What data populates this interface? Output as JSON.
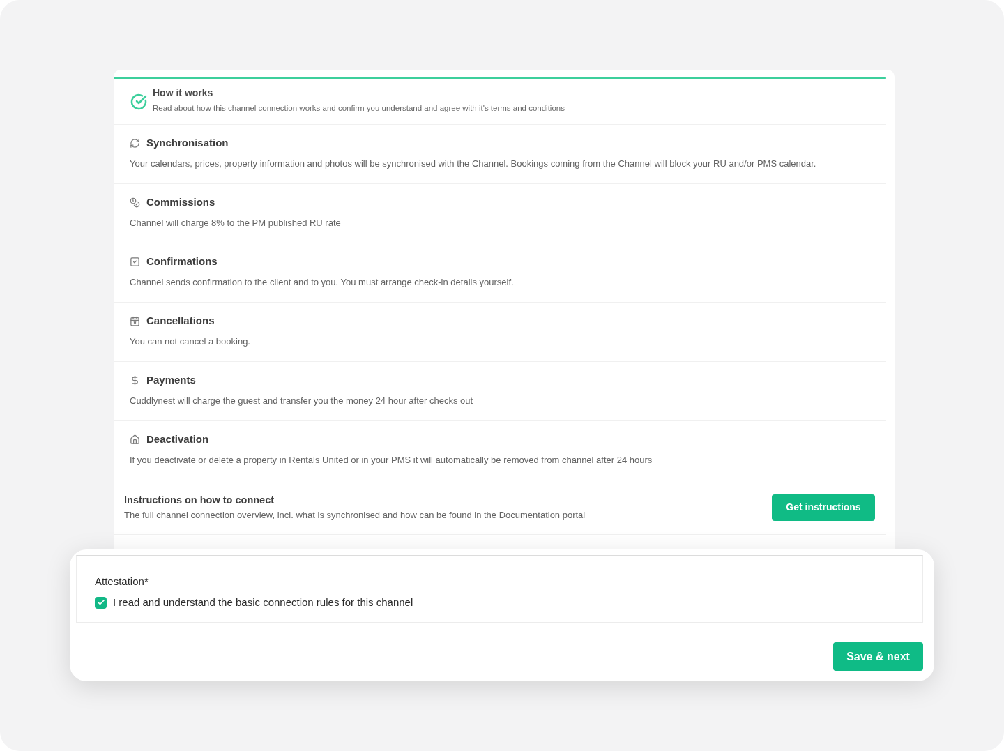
{
  "header": {
    "title": "How it works",
    "subtitle": "Read about how this channel connection works and confirm you understand and agree with it's terms and conditions"
  },
  "sections": [
    {
      "title": "Synchronisation",
      "description": "Your calendars, prices, property information and photos will be synchronised with the Channel. Bookings coming from the Channel will block your RU and/or PMS calendar."
    },
    {
      "title": "Commissions",
      "description": "Channel will charge 8% to the PM published RU rate"
    },
    {
      "title": "Confirmations",
      "description": "Channel sends confirmation to the client and to you. You must arrange check-in details yourself."
    },
    {
      "title": "Cancellations",
      "description": "You can not cancel a booking."
    },
    {
      "title": "Payments",
      "description": "Cuddlynest will charge the guest and transfer you the money 24 hour after checks out"
    },
    {
      "title": "Deactivation",
      "description": "If you deactivate or delete a property in Rentals United or in your PMS it will automatically be removed from channel after 24 hours"
    }
  ],
  "instructions": {
    "title": "Instructions on how to connect",
    "description": "The full channel connection overview, incl. what is synchronised and how can be found in the Documentation portal",
    "button": "Get instructions"
  },
  "attestation": {
    "label": "Attestation*",
    "checkbox": {
      "label": "I read and understand the basic connection rules for this channel",
      "checked": true
    }
  },
  "primary_button": "Save & next"
}
